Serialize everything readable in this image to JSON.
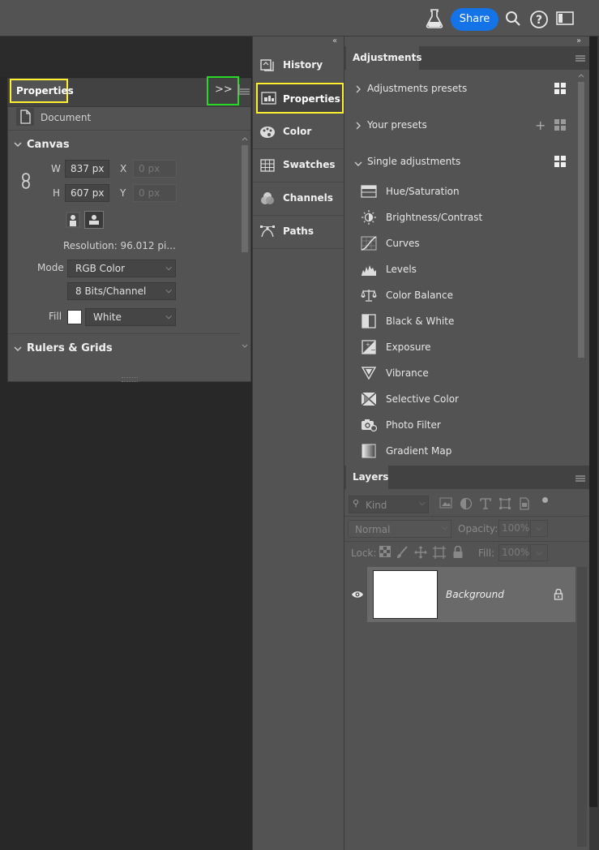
{
  "topbar": {
    "share_label": "Share",
    "icons": [
      "flask-icon",
      "search-icon",
      "help-icon",
      "workspace-icon"
    ]
  },
  "floating_properties": {
    "tab_label": "Properties",
    "expand_label": ">>",
    "doc_label": "Document",
    "canvas": {
      "title": "Canvas",
      "w_label": "W",
      "w_value": "837 px",
      "h_label": "H",
      "h_value": "607 px",
      "x_label": "X",
      "x_placeholder": "0 px",
      "y_label": "Y",
      "y_placeholder": "0 px",
      "resolution": "Resolution: 96.012 pi...",
      "mode_label": "Mode",
      "mode_value": "RGB Color",
      "bits_value": "8 Bits/Channel",
      "fill_label": "Fill",
      "fill_value": "White"
    },
    "rulers_title": "Rulers & Grids"
  },
  "mid_column": {
    "items": [
      {
        "label": "History",
        "icon": "history-icon"
      },
      {
        "label": "Properties",
        "icon": "properties-icon"
      },
      {
        "label": "Color",
        "icon": "color-palette-icon"
      },
      {
        "label": "Swatches",
        "icon": "swatches-grid-icon"
      },
      {
        "label": "Channels",
        "icon": "channels-icon"
      },
      {
        "label": "Paths",
        "icon": "paths-icon"
      }
    ]
  },
  "adjustments": {
    "tab_label": "Adjustments",
    "presets_label": "Adjustments presets",
    "your_presets_label": "Your presets",
    "single_label": "Single adjustments",
    "items": [
      {
        "label": "Hue/Saturation",
        "icon": "hue-saturation-icon"
      },
      {
        "label": "Brightness/Contrast",
        "icon": "brightness-contrast-icon"
      },
      {
        "label": "Curves",
        "icon": "curves-icon"
      },
      {
        "label": "Levels",
        "icon": "levels-icon"
      },
      {
        "label": "Color Balance",
        "icon": "color-balance-icon"
      },
      {
        "label": "Black & White",
        "icon": "black-white-icon"
      },
      {
        "label": "Exposure",
        "icon": "exposure-icon"
      },
      {
        "label": "Vibrance",
        "icon": "vibrance-icon"
      },
      {
        "label": "Selective Color",
        "icon": "selective-color-icon"
      },
      {
        "label": "Photo Filter",
        "icon": "photo-filter-icon"
      },
      {
        "label": "Gradient Map",
        "icon": "gradient-map-icon"
      }
    ]
  },
  "layers": {
    "tab_label": "Layers",
    "kind_placeholder": "Kind",
    "blend_mode": "Normal",
    "opacity_label": "Opacity:",
    "opacity_value": "100%",
    "lock_label": "Lock:",
    "fill_label": "Fill:",
    "fill_value": "100%",
    "layer_name": "Background"
  },
  "colors": {
    "accent": "#1473e6",
    "highlight_yellow": "#ffef32",
    "highlight_green": "#28d828",
    "panel_bg": "#535353"
  }
}
